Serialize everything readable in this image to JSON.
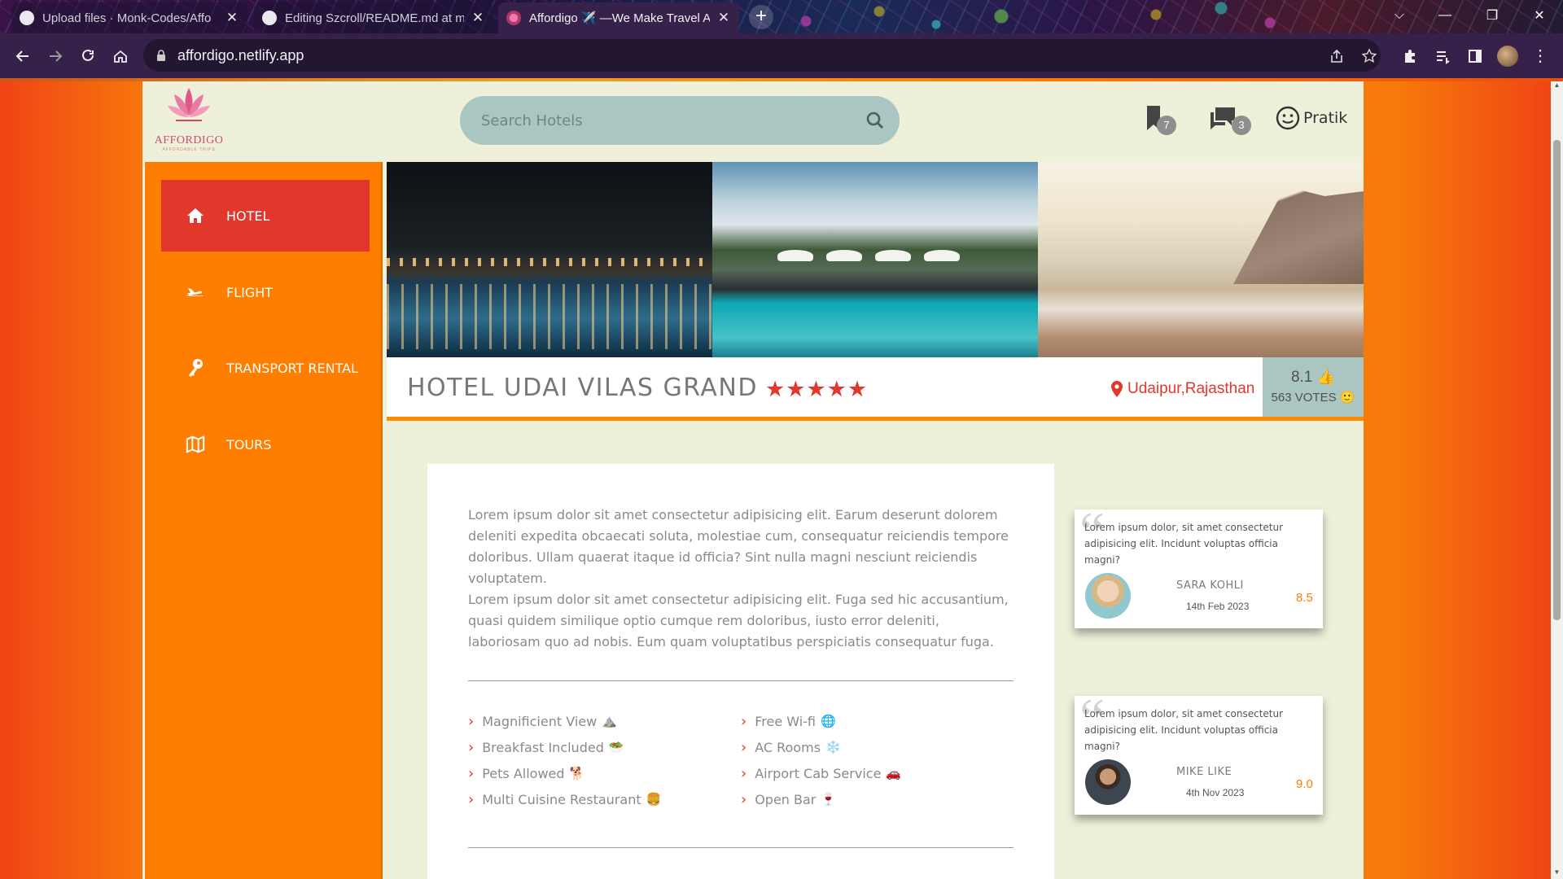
{
  "browser": {
    "tabs": [
      {
        "title": "Upload files · Monk-Codes/Affo",
        "active": false
      },
      {
        "title": "Editing Szcroll/README.md at m",
        "active": false
      },
      {
        "title": "Affordigo ✈️ —We Make Travel A",
        "active": true
      }
    ],
    "url": "affordigo.netlify.app"
  },
  "header": {
    "logo_name": "AFFORDIGO",
    "logo_tagline": "AFFORDABLE TRIPS",
    "search_placeholder": "Search Hotels",
    "bookmarks_count": "7",
    "messages_count": "3",
    "user_name": "Pratik"
  },
  "sidebar": {
    "items": [
      {
        "label": "HOTEL",
        "icon": "home-icon",
        "active": true
      },
      {
        "label": "FLIGHT",
        "icon": "airplane-icon",
        "active": false
      },
      {
        "label": "TRANSPORT RENTAL",
        "icon": "key-icon",
        "active": false
      },
      {
        "label": "TOURS",
        "icon": "map-icon",
        "active": false
      }
    ]
  },
  "hotel": {
    "name": "HOTEL UDAI VILAS GRAND",
    "stars": "★★★★★",
    "location": "Udaipur,Rajasthan",
    "score": "8.1",
    "votes": "563 VOTES"
  },
  "description": {
    "p1": "Lorem ipsum dolor sit amet consectetur adipisicing elit. Earum deserunt dolorem deleniti expedita obcaecati soluta, molestiae cum, consequatur reiciendis tempore doloribus. Ullam quaerat itaque id officia? Sint nulla magni nesciunt reiciendis voluptatem.",
    "p2": "Lorem ipsum dolor sit amet consectetur adipisicing elit. Fuga sed hic accusantium, quasi quidem similique optio cumque rem doloribus, iusto error deleniti, laboriosam quo ad nobis. Eum quam voluptatibus perspiciatis consequatur fuga."
  },
  "amenities": {
    "left": [
      {
        "label": "Magnificient View",
        "emoji": "⛰️"
      },
      {
        "label": "Breakfast Included",
        "emoji": "🥗"
      },
      {
        "label": "Pets Allowed",
        "emoji": "🐕"
      },
      {
        "label": "Multi Cuisine Restaurant",
        "emoji": "🍔"
      }
    ],
    "right": [
      {
        "label": "Free Wi-fi",
        "emoji": "🌐"
      },
      {
        "label": "AC Rooms",
        "emoji": "❄️"
      },
      {
        "label": "Airport Cab Service",
        "emoji": "🚗"
      },
      {
        "label": "Open Bar",
        "emoji": "🍷"
      }
    ]
  },
  "reviews": [
    {
      "text": "Lorem ipsum dolor, sit amet consectetur adipisicing elit. Incidunt voluptas officia magni?",
      "name": "SARA KOHLI",
      "date": "14th Feb 2023",
      "score": "8.5"
    },
    {
      "text": "Lorem ipsum dolor, sit amet consectetur adipisicing elit. Incidunt voluptas officia magni?",
      "name": "MIKE LIKE",
      "date": "4th Nov 2023",
      "score": "9.0"
    }
  ],
  "colors": {
    "accent": "#ff7e00",
    "active_nav": "#e2372d",
    "rating_bg": "#a9c6c2",
    "page_bg": "#eef0da"
  }
}
